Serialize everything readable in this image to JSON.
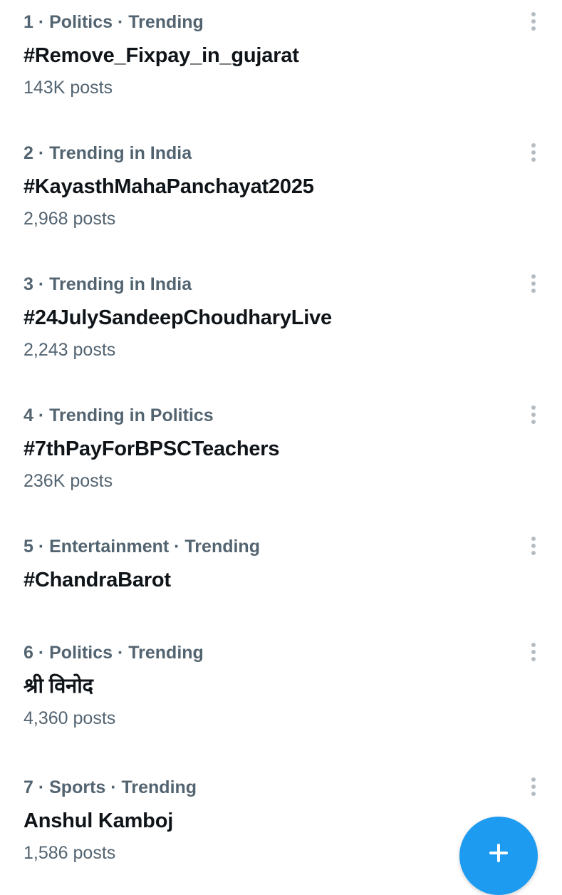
{
  "trends": [
    {
      "meta": "1 · Politics · Trending",
      "title": "#Remove_Fixpay_in_gujarat",
      "count": "143K posts"
    },
    {
      "meta": "2 · Trending in India",
      "title": "#KayasthMahaPanchayat2025",
      "count": "2,968 posts"
    },
    {
      "meta": "3 · Trending in India",
      "title": "#24JulySandeepChoudharyLive",
      "count": "2,243 posts"
    },
    {
      "meta": "4 · Trending in Politics",
      "title": "#7thPayForBPSCTeachers",
      "count": "236K posts"
    },
    {
      "meta": "5 · Entertainment · Trending",
      "title": "#ChandraBarot",
      "count": ""
    },
    {
      "meta": "6 · Politics · Trending",
      "title": "श्री विनोद",
      "count": "4,360 posts"
    },
    {
      "meta": "7 · Sports · Trending",
      "title": "Anshul Kamboj",
      "count": "1,586 posts"
    }
  ],
  "icons": {
    "more": "more-vertical-icon",
    "compose": "plus-icon"
  },
  "colors": {
    "accent": "#1d9bf0",
    "primary_text": "#0f1419",
    "secondary_text": "#536471"
  }
}
